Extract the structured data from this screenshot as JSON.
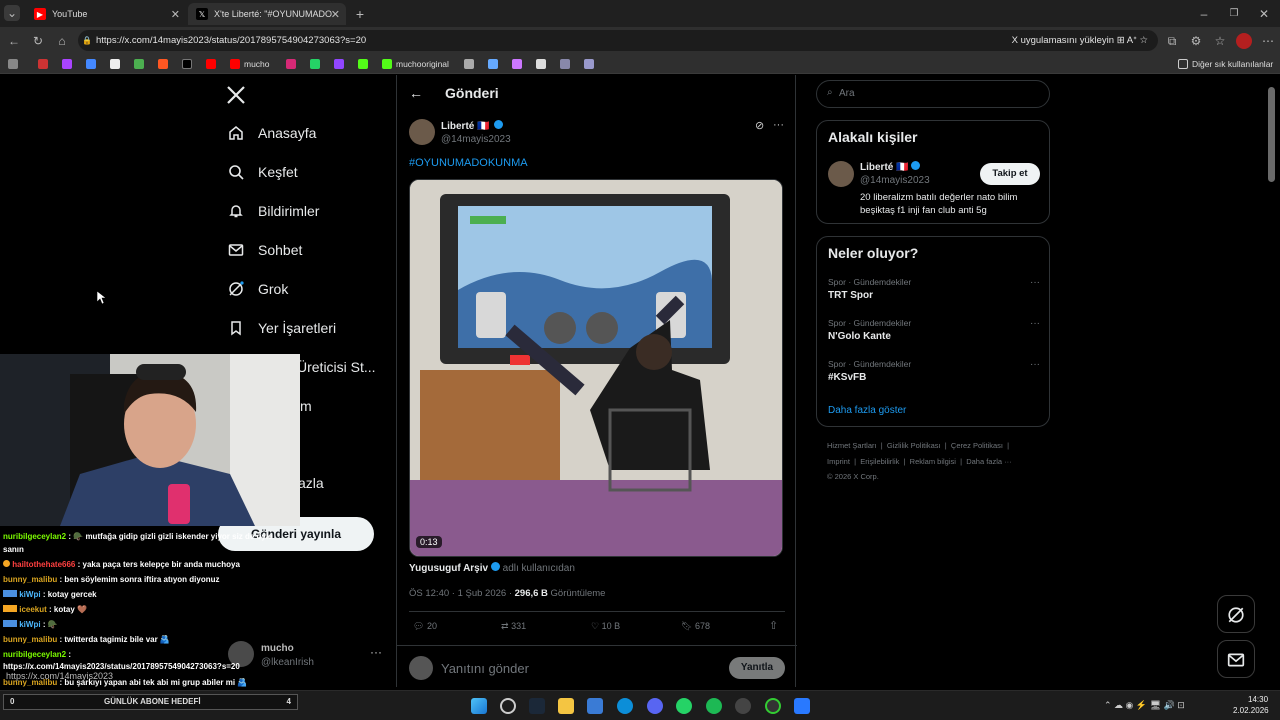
{
  "browser": {
    "tabs": [
      {
        "label": "YouTube"
      },
      {
        "label": "X'te Liberté: \"#OYUNUMADOKU"
      }
    ],
    "url": "https://x.com/14mayis2023/status/2017895754904273063?s=20",
    "install_prompt": "X uygulamasını yükleyin",
    "bookmarks": {
      "mucho": "mucho",
      "muchooriginal": "muchooriginal",
      "other": "Diğer sık kullanılanlar"
    }
  },
  "nav": {
    "items": [
      {
        "label": "Anasayfa"
      },
      {
        "label": "Keşfet"
      },
      {
        "label": "Bildirimler"
      },
      {
        "label": "Sohbet"
      },
      {
        "label": "Grok"
      },
      {
        "label": "Yer İşaretleri"
      },
      {
        "label": "Üreticisi St..."
      },
      {
        "label": "m"
      },
      {
        "label": "azla"
      }
    ],
    "post_button": "Gönderi yayınla",
    "account": {
      "name": "mucho",
      "handle": "@lkeanIrish"
    }
  },
  "post": {
    "header": "Gönderi",
    "author_name": "Liberté 🇫🇷",
    "author_handle": "@14mayis2023",
    "hashtag": "#OYUNUMADOKUNMA",
    "video_time": "0:13",
    "source_name": "Yugusuguf Arşiv",
    "source_suffix": "adlı kullanıcıdan",
    "timestamp": "ÖS 12:40 · 1 Şub 2026 · ",
    "views_count": "296,6 B",
    "views_label": " Görüntüleme",
    "stats": {
      "replies": "20",
      "reposts": "331",
      "likes": "10 B",
      "bookmarks": "678"
    },
    "reply_placeholder": "Yanıtını gönder",
    "reply_button": "Yanıtla"
  },
  "sidebar": {
    "search_placeholder": "Ara",
    "relevant_title": "Alakalı kişiler",
    "person": {
      "name": "Liberté 🇫🇷",
      "handle": "@14mayis2023",
      "bio": "20 liberalizm batılı değerler nato bilim beşiktaş f1 inji fan club anti 5g",
      "follow": "Takip et"
    },
    "trends_title": "Neler oluyor?",
    "trends": [
      {
        "context": "Spor · Gündemdekiler",
        "name": "TRT Spor"
      },
      {
        "context": "Spor · Gündemdekiler",
        "name": "N'Golo Kante"
      },
      {
        "context": "Spor · Gündemdekiler",
        "name": "#KSvFB"
      }
    ],
    "show_more": "Daha fazla göster",
    "footer_line1": "Hizmet Şartları  |  Gizlilik Politikası  |  Çerez Politikası  |",
    "footer_line2": "Imprint  |  Erişilebilirlik  |  Reklam bilgisi  |  Daha fazla ···",
    "footer_line3": "© 2026 X Corp."
  },
  "stream": {
    "chat": [
      {
        "user": "nuribilgeceylan2",
        "text": ": 🪖 mutfağa gidip gizli gizli iskender yiyor siz de öyle",
        "color": "#7cfc00"
      },
      {
        "user": "",
        "text": "sanın",
        "color": "#ffffff"
      },
      {
        "user": "hailtothehate666",
        "text": ": yaka paça ters kelepçe bir anda muchoya",
        "color": "#ff4040"
      },
      {
        "user": "bunny_malibu",
        "text": ": ben söylemim sonra iftira atıyon diyonuz",
        "color": "#daa520"
      },
      {
        "user": "kiWpi",
        "text": ": kotay gercek",
        "color": "#4db8ff"
      },
      {
        "user": "iceekut",
        "text": ": kotay 🤎",
        "color": "#daa520"
      },
      {
        "user": "kiWpi",
        "text": ": 🪖",
        "color": "#4db8ff"
      },
      {
        "user": "bunny_malibu",
        "text": ": twitterda tagimiz bile var 🫂",
        "color": "#daa520"
      },
      {
        "user": "nuribilgeceylan2",
        "text": ":",
        "color": "#7cfc00"
      },
      {
        "user": "",
        "text": "https://x.com/14mayis2023/status/2017895754904273063?s=20",
        "color": "#ffffff"
      },
      {
        "user": "bunny_malibu",
        "text": ": bu şarkıyı yapan abi tek abi mi grup abiler mi 🫂",
        "color": "#daa520"
      }
    ],
    "status_url": "https://x.com/14mayis2023",
    "goal_label": "GÜNLÜK ABONE HEDEFİ",
    "goal_current": "0",
    "goal_target": "4"
  },
  "taskbar": {
    "time": "14:30",
    "date": "2.02.2026"
  }
}
